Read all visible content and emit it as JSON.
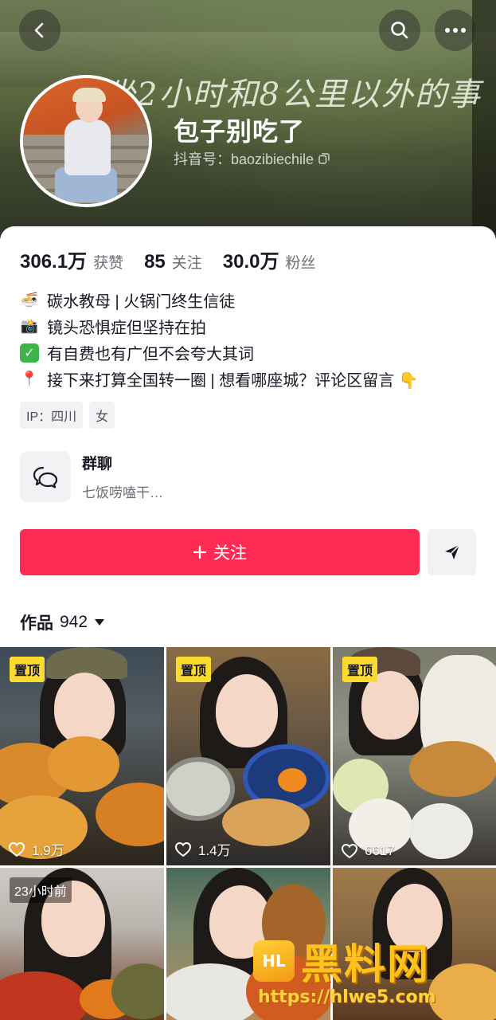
{
  "header": {
    "banner_text": "坐2小时和8公里以外的事",
    "nickname": "包子别吃了",
    "douyin_id": "抖音号：baozibiechile",
    "icons": [
      "back-icon",
      "search-icon",
      "more-icon",
      "copy-icon"
    ]
  },
  "stats": [
    {
      "value": "306.1万",
      "label": "获赞"
    },
    {
      "value": "85",
      "label": "关注"
    },
    {
      "value": "30.0万",
      "label": "粉丝"
    }
  ],
  "bio": [
    {
      "emoji": "🍜",
      "icon": "noodle-bowl-icon",
      "text": "碳水教母 | 火锅门终生信徒"
    },
    {
      "emoji": "📸",
      "icon": "camera-flash-icon",
      "text": "镜头恐惧症但坚持在拍"
    },
    {
      "emoji": "✓",
      "icon": "check-mark-icon",
      "text": "有自费也有广但不会夸大其词"
    },
    {
      "emoji": "📍",
      "icon": "pin-icon",
      "text": "接下来打算全国转一圈 | 想看哪座城？评论区留言 👇"
    }
  ],
  "tags": [
    "IP：四川",
    "女"
  ],
  "group_chat": {
    "title": "群聊",
    "subtitle": "七饭唠嗑干…"
  },
  "follow_button": "关注",
  "works_tab": {
    "label": "作品",
    "count": "942"
  },
  "videos": [
    {
      "badge": "置顶",
      "likes": "1.9万"
    },
    {
      "badge": "置顶",
      "likes": "1.4万"
    },
    {
      "badge": "置顶",
      "likes": "6617"
    },
    {
      "badge": "23小时前",
      "likes": ""
    },
    {
      "badge": "",
      "likes": ""
    },
    {
      "badge": "",
      "likes": ""
    }
  ],
  "watermark": {
    "logo": "HL",
    "text": "黑料网",
    "url": "https://hlwe5.com"
  },
  "colors": {
    "accent": "#fe2c55",
    "pin_badge": "#fddb2e"
  }
}
